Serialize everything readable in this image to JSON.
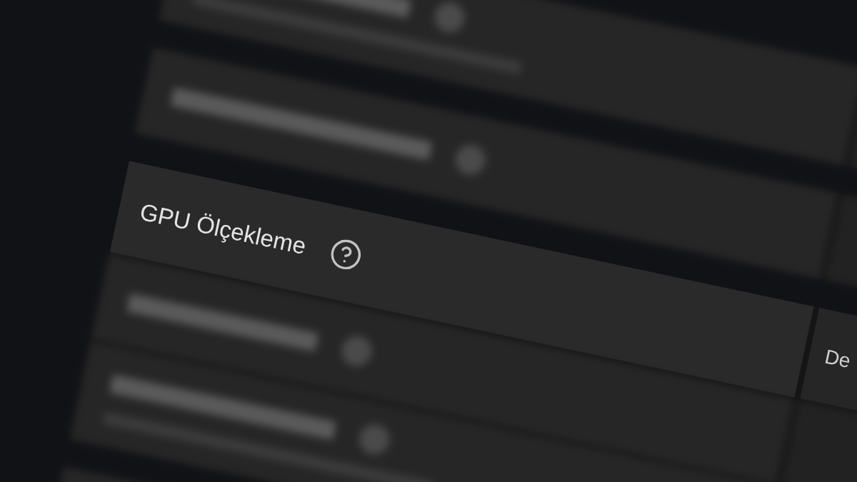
{
  "settings": {
    "groups": [
      {
        "rows": [
          {
            "kind": "blurred_two_line",
            "help_icon": true
          }
        ]
      },
      {
        "rows": [
          {
            "kind": "blurred",
            "help_icon": true
          }
        ]
      },
      {
        "rows": [
          {
            "kind": "focused",
            "label": "GPU Ölçekleme",
            "help_icon": true,
            "value": "De"
          },
          {
            "kind": "blurred",
            "help_icon": true
          },
          {
            "kind": "blurred_two_line",
            "help_icon": true
          }
        ]
      },
      {
        "rows": [
          {
            "kind": "blurred"
          }
        ]
      }
    ]
  }
}
